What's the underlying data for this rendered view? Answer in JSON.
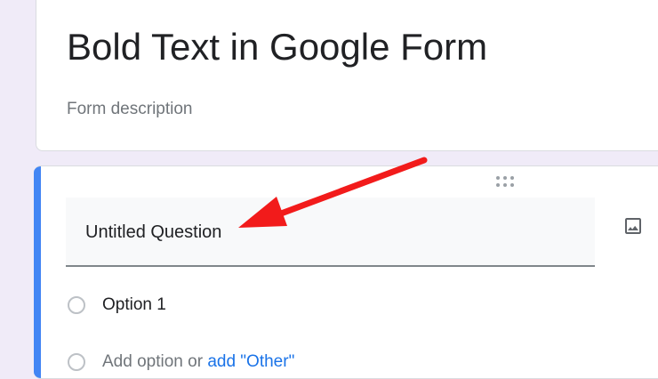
{
  "header": {
    "title": "Bold Text in Google Form",
    "description_placeholder": "Form description"
  },
  "question": {
    "title": "Untitled Question",
    "options": [
      {
        "label": "Option 1"
      }
    ],
    "add_option_label": "Add option",
    "or_label": "or",
    "add_other_label": "add \"Other\""
  },
  "icons": {
    "drag": "drag-handle-icon",
    "image": "image-icon"
  },
  "colors": {
    "accent": "#4285f4",
    "link": "#1a73e8",
    "background": "#f0ebf8",
    "annotation": "#f21b1b"
  }
}
